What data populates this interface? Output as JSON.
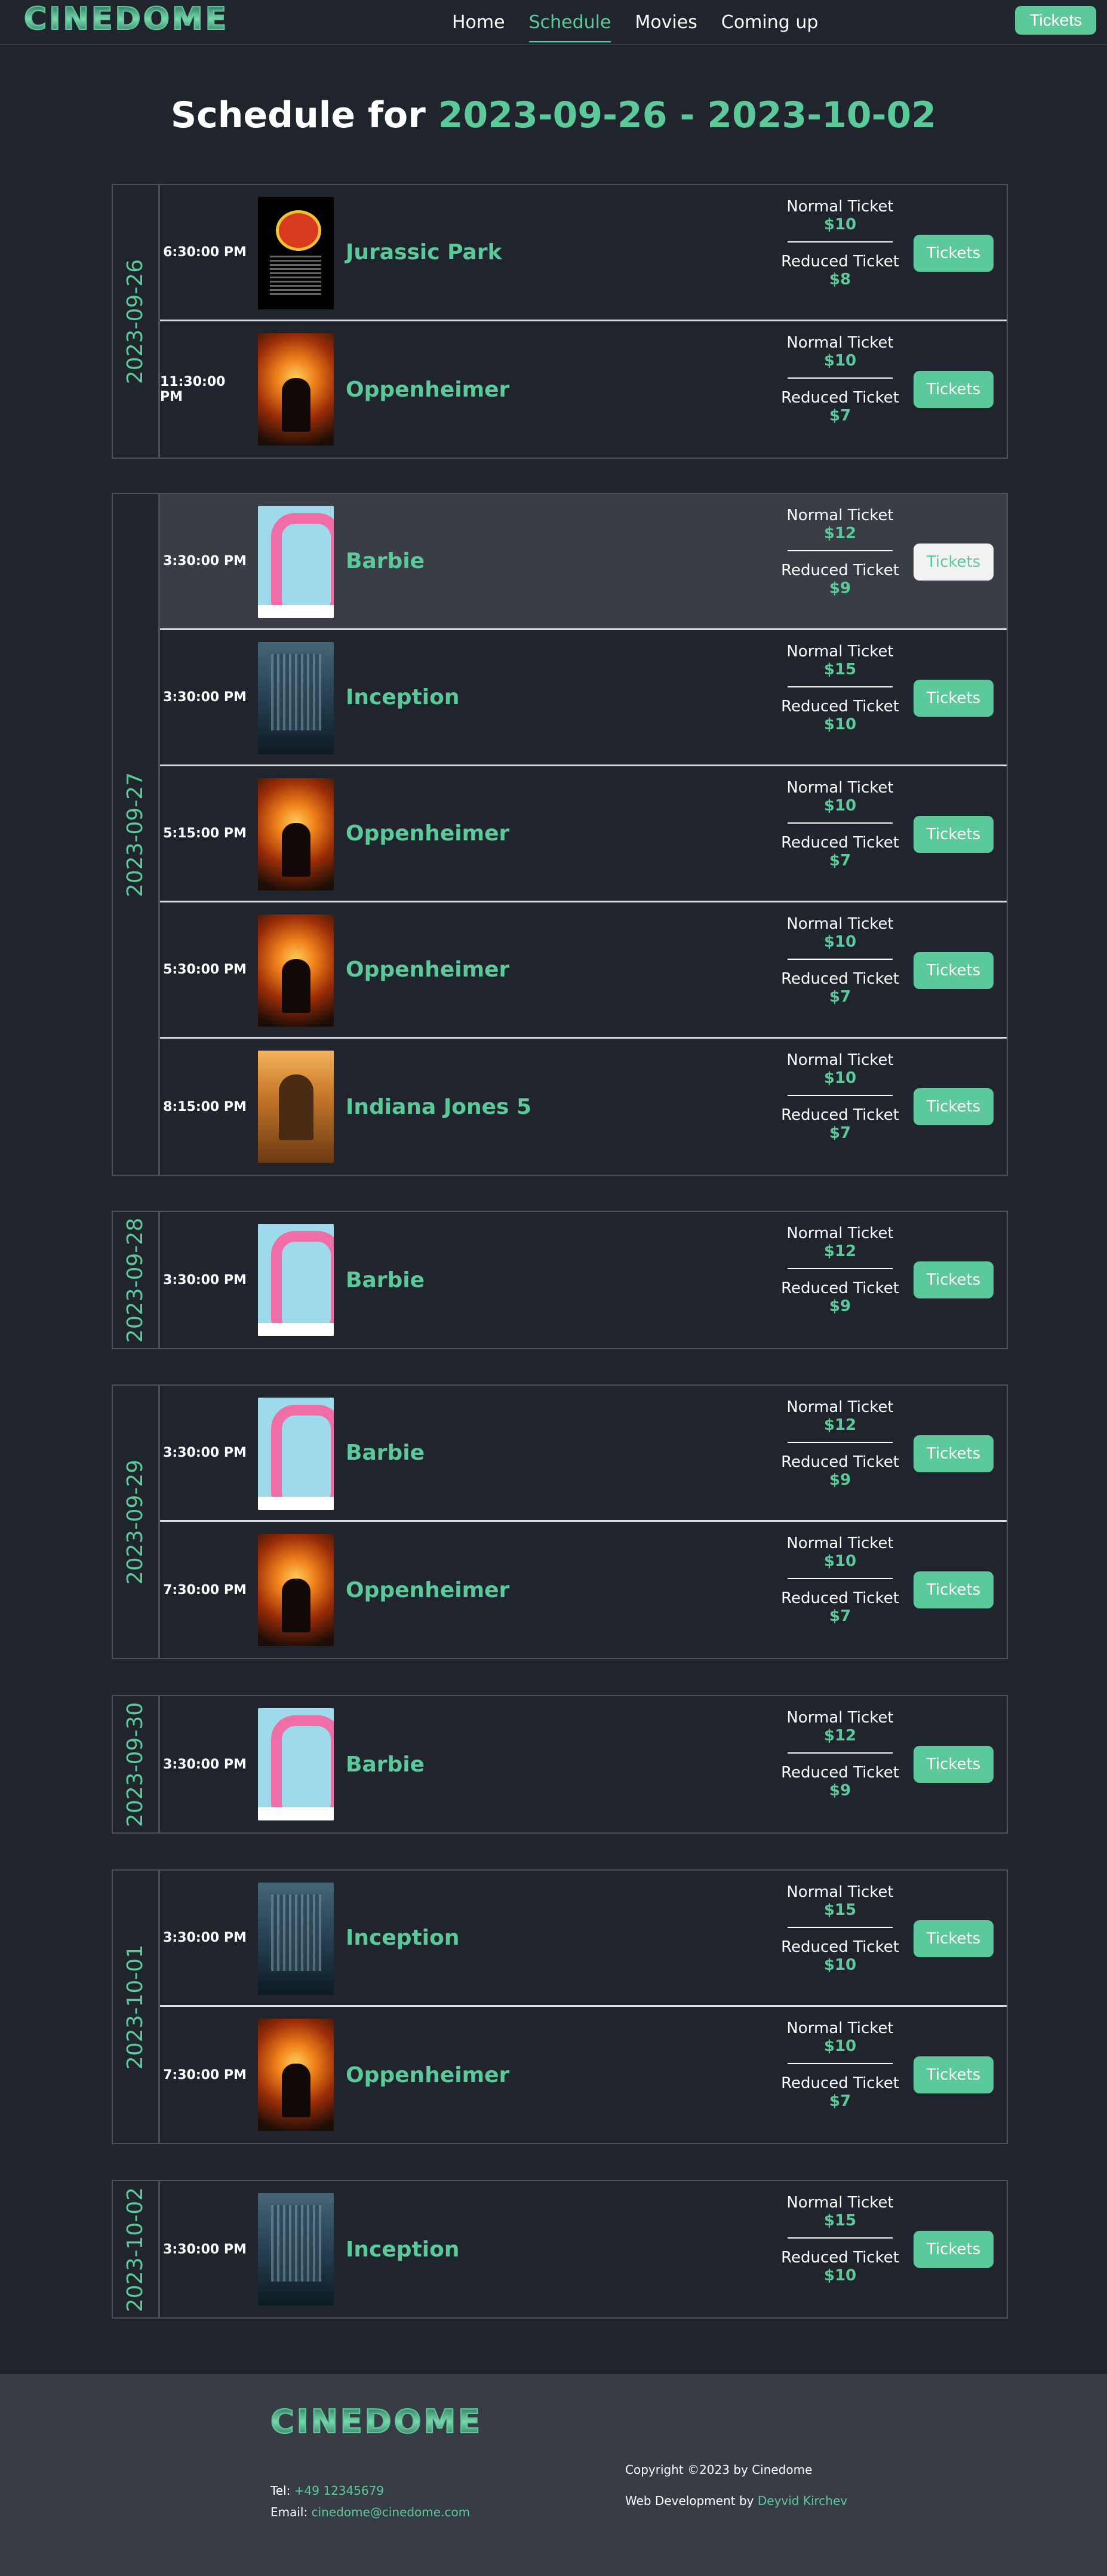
{
  "nav": {
    "logo": "CINEDOME",
    "links": [
      "Home",
      "Schedule",
      "Movies",
      "Coming up"
    ],
    "tickets_label": "Tickets"
  },
  "title": {
    "prefix": "Schedule for",
    "start": "2023-09-26",
    "separator": "-",
    "end": "2023-10-02"
  },
  "labels": {
    "normal": "Normal Ticket",
    "reduced": "Reduced Ticket",
    "button": "Tickets"
  },
  "days": [
    {
      "date": "2023-09-26",
      "shows": [
        {
          "time": "6:30:00 PM",
          "movie": "Jurassic Park",
          "poster": "jurassic-park-poster",
          "normal": "$10",
          "reduced": "$8"
        },
        {
          "time": "11:30:00 PM",
          "movie": "Oppenheimer",
          "poster": "oppenheimer-poster",
          "normal": "$10",
          "reduced": "$7"
        }
      ]
    },
    {
      "date": "2023-09-27",
      "shows": [
        {
          "time": "3:30:00 PM",
          "movie": "Barbie",
          "poster": "barbie-poster",
          "normal": "$12",
          "reduced": "$9"
        },
        {
          "time": "3:30:00 PM",
          "movie": "Inception",
          "poster": "inception-poster",
          "normal": "$15",
          "reduced": "$10"
        },
        {
          "time": "5:15:00 PM",
          "movie": "Oppenheimer",
          "poster": "oppenheimer-poster",
          "normal": "$10",
          "reduced": "$7"
        },
        {
          "time": "5:30:00 PM",
          "movie": "Oppenheimer",
          "poster": "oppenheimer-poster",
          "normal": "$10",
          "reduced": "$7"
        },
        {
          "time": "8:15:00 PM",
          "movie": "Indiana Jones 5",
          "poster": "indiana-jones-poster",
          "normal": "$10",
          "reduced": "$7"
        }
      ]
    },
    {
      "date": "2023-09-28",
      "shows": [
        {
          "time": "3:30:00 PM",
          "movie": "Barbie",
          "poster": "barbie-poster",
          "normal": "$12",
          "reduced": "$9"
        }
      ]
    },
    {
      "date": "2023-09-29",
      "shows": [
        {
          "time": "3:30:00 PM",
          "movie": "Barbie",
          "poster": "barbie-poster",
          "normal": "$12",
          "reduced": "$9"
        },
        {
          "time": "7:30:00 PM",
          "movie": "Oppenheimer",
          "poster": "oppenheimer-poster",
          "normal": "$10",
          "reduced": "$7"
        }
      ]
    },
    {
      "date": "2023-09-30",
      "shows": [
        {
          "time": "3:30:00 PM",
          "movie": "Barbie",
          "poster": "barbie-poster",
          "normal": "$12",
          "reduced": "$9"
        }
      ]
    },
    {
      "date": "2023-10-01",
      "shows": [
        {
          "time": "3:30:00 PM",
          "movie": "Inception",
          "poster": "inception-poster",
          "normal": "$15",
          "reduced": "$10"
        },
        {
          "time": "7:30:00 PM",
          "movie": "Oppenheimer",
          "poster": "oppenheimer-poster",
          "normal": "$10",
          "reduced": "$7"
        }
      ]
    },
    {
      "date": "2023-10-02",
      "shows": [
        {
          "time": "3:30:00 PM",
          "movie": "Inception",
          "poster": "inception-poster",
          "normal": "$15",
          "reduced": "$10"
        }
      ]
    }
  ],
  "footer": {
    "logo": "CINEDOME",
    "tel_label": "Tel:",
    "tel": "+49 12345679",
    "email_label": "Email:",
    "email": "cinedome@cinedome.com",
    "copyright": "Copyright ©2023 by Cinedome",
    "dev_label": "Web Development by",
    "dev_name": "Deyvid Kirchev"
  },
  "colors": {
    "accent": "#5cc99b",
    "background": "#20252d",
    "footer": "#383c44"
  }
}
